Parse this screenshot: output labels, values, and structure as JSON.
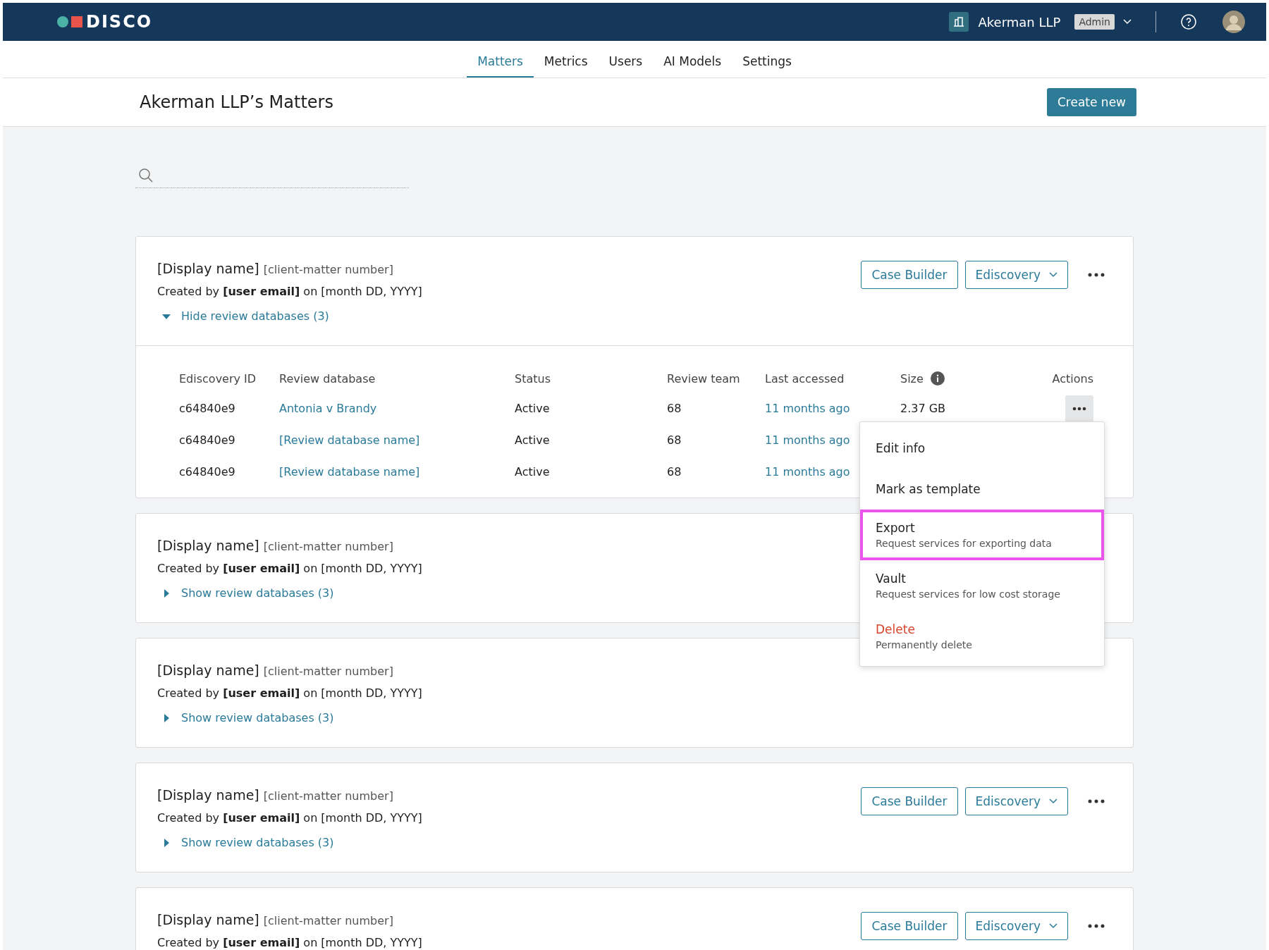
{
  "header": {
    "logo": "DISCO",
    "org": "Akerman LLP",
    "role": "Admin"
  },
  "nav_tabs": [
    {
      "label": "Matters",
      "selected": true
    },
    {
      "label": "Metrics",
      "selected": false
    },
    {
      "label": "Users",
      "selected": false
    },
    {
      "label": "AI Models",
      "selected": false
    },
    {
      "label": "Settings",
      "selected": false
    }
  ],
  "page": {
    "title": "Akerman LLP’s Matters",
    "create_button": "Create new"
  },
  "matters": [
    {
      "display_name": "[Display name]",
      "number": "[client-matter number]",
      "created": "Created by **[user email]** on [month DD, YYYY]",
      "toggle": "Hide review databases (3)",
      "expanded": true,
      "buttons": [
        "Case Builder",
        "Ediscovery"
      ],
      "databases": {
        "columns": [
          "Ediscovery ID",
          "Review database",
          "Status",
          "Review team",
          "Last accessed",
          "Size",
          "Actions"
        ],
        "rows": [
          {
            "id": "c64840e9",
            "database": "Antonia v Brandy",
            "status": "Active",
            "team": "68",
            "last_accessed": "11 months ago",
            "size": "2.37 GB",
            "actions": {
              "open": true
            }
          },
          {
            "id": "c64840e9",
            "database": "[Review database name]",
            "status": "Active",
            "team": "68",
            "last_accessed": "11 months ago"
          },
          {
            "id": "c64840e9",
            "database": "[Review database name]",
            "status": "Active",
            "team": "68",
            "last_accessed": "11 months ago"
          }
        ]
      }
    },
    {
      "display_name": "[Display name]",
      "number": "[client-matter number]",
      "created": "Created by **[user email]** on [month DD, YYYY]",
      "toggle": "Show review databases (3)",
      "expanded": false
    },
    {
      "display_name": "[Display name]",
      "number": "[client-matter number]",
      "created": "Created by **[user email]** on [month DD, YYYY]",
      "toggle": "Show review databases (3)",
      "expanded": false
    },
    {
      "display_name": "[Display name]",
      "number": "[client-matter number]",
      "created": "Created by **[user email]** on [month DD, YYYY]",
      "toggle": "Show review databases (3)",
      "expanded": false,
      "buttons": [
        "Case Builder",
        "Ediscovery"
      ]
    },
    {
      "display_name": "[Display name]",
      "number": "[client-matter number]",
      "created": "Created by **[user email]** on [month DD, YYYY]",
      "buttons": [
        "Case Builder",
        "Ediscovery"
      ]
    }
  ],
  "menu": {
    "items": [
      {
        "label": "Edit info",
        "kind": "normal",
        "highlighted": false
      },
      {
        "label": "Mark as template",
        "kind": "normal",
        "highlighted": false
      },
      {
        "label": "Export",
        "description": "Request services for exporting data",
        "kind": "normal",
        "highlighted": true
      },
      {
        "label": "Vault",
        "description": "Request services for low cost storage",
        "kind": "normal",
        "highlighted": false
      },
      {
        "label": "Delete",
        "description": "Permanently delete",
        "kind": "danger",
        "highlighted": false
      }
    ]
  }
}
